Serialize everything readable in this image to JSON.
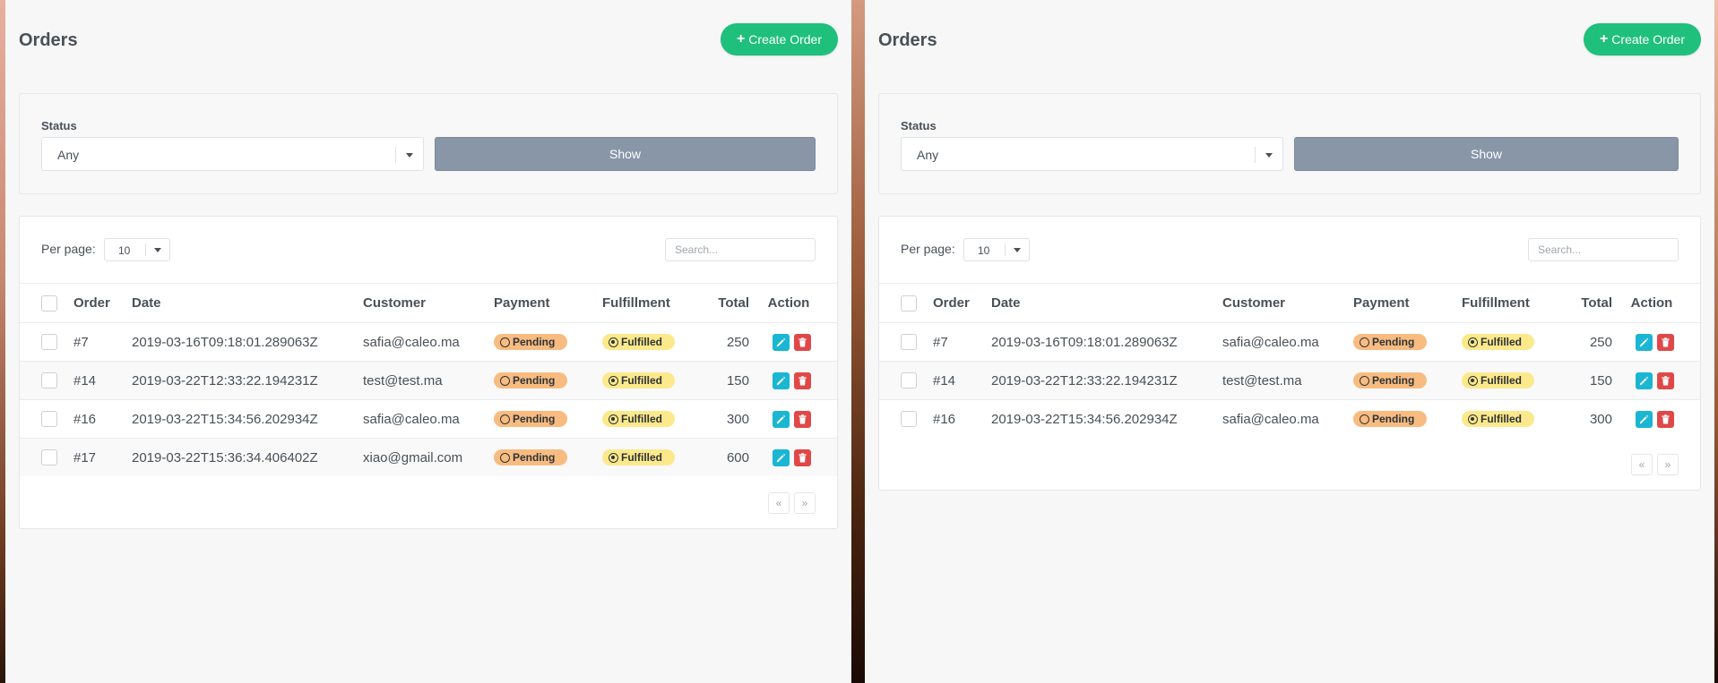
{
  "panes": [
    {
      "title": "Orders",
      "create_label": "Create Order",
      "filter": {
        "status_label": "Status",
        "status_value": "Any",
        "show_label": "Show"
      },
      "table": {
        "per_page_label": "Per page:",
        "per_page_value": "10",
        "search_placeholder": "Search...",
        "columns": [
          "Order",
          "Date",
          "Customer",
          "Payment",
          "Fulfillment",
          "Total",
          "Action"
        ],
        "rows": [
          {
            "order": "#7",
            "date": "2019-03-16T09:18:01.289063Z",
            "customer": "safia@caleo.ma",
            "payment": "Pending",
            "fulfillment": "Fulfilled",
            "total": "250"
          },
          {
            "order": "#14",
            "date": "2019-03-22T12:33:22.194231Z",
            "customer": "test@test.ma",
            "payment": "Pending",
            "fulfillment": "Fulfilled",
            "total": "150"
          },
          {
            "order": "#16",
            "date": "2019-03-22T15:34:56.202934Z",
            "customer": "safia@caleo.ma",
            "payment": "Pending",
            "fulfillment": "Fulfilled",
            "total": "300"
          },
          {
            "order": "#17",
            "date": "2019-03-22T15:36:34.406402Z",
            "customer": "xiao@gmail.com",
            "payment": "Pending",
            "fulfillment": "Fulfilled",
            "total": "600"
          }
        ],
        "pager": {
          "prev": "«",
          "next": "»"
        }
      }
    },
    {
      "title": "Orders",
      "create_label": "Create Order",
      "filter": {
        "status_label": "Status",
        "status_value": "Any",
        "show_label": "Show"
      },
      "table": {
        "per_page_label": "Per page:",
        "per_page_value": "10",
        "search_placeholder": "Search...",
        "columns": [
          "Order",
          "Date",
          "Customer",
          "Payment",
          "Fulfillment",
          "Total",
          "Action"
        ],
        "rows": [
          {
            "order": "#7",
            "date": "2019-03-16T09:18:01.289063Z",
            "customer": "safia@caleo.ma",
            "payment": "Pending",
            "fulfillment": "Fulfilled",
            "total": "250"
          },
          {
            "order": "#14",
            "date": "2019-03-22T12:33:22.194231Z",
            "customer": "test@test.ma",
            "payment": "Pending",
            "fulfillment": "Fulfilled",
            "total": "150"
          },
          {
            "order": "#16",
            "date": "2019-03-22T15:34:56.202934Z",
            "customer": "safia@caleo.ma",
            "payment": "Pending",
            "fulfillment": "Fulfilled",
            "total": "300"
          }
        ],
        "pager": {
          "prev": "«",
          "next": "»"
        }
      }
    }
  ],
  "colors": {
    "accent_green": "#1fbf7c",
    "show_button": "#8996a8",
    "pending_badge": "#f8bc80",
    "fulfilled_badge": "#fce98b",
    "edit_button": "#1ab6d3",
    "delete_button": "#e04848"
  },
  "icons": {
    "create": "plus-icon",
    "payment_status": "ring-icon",
    "fulfillment_status": "dot-icon",
    "edit": "pencil-icon",
    "delete": "trash-icon",
    "dropdown": "caret-down-icon"
  }
}
